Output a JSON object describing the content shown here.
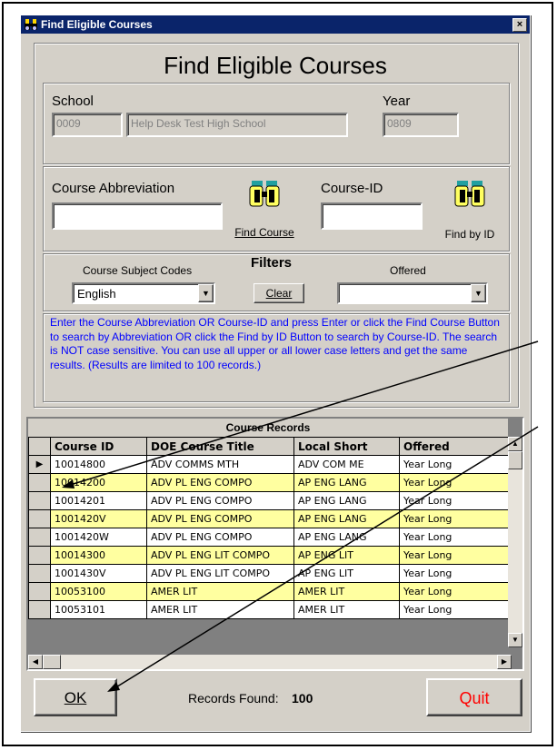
{
  "window": {
    "title": "Find Eligible Courses",
    "close_glyph": "×"
  },
  "header": {
    "title": "Find Eligible Courses"
  },
  "school": {
    "label": "School",
    "code": "0009",
    "name": "Help Desk Test High School"
  },
  "year": {
    "label": "Year",
    "value": "0809"
  },
  "search": {
    "abbrev_label": "Course Abbreviation",
    "abbrev_value": "",
    "find_course_label": "Find Course",
    "courseid_label": "Course-ID",
    "courseid_value": "",
    "find_by_id_label": "Find by ID"
  },
  "filters": {
    "title": "Filters",
    "subject_label": "Course Subject Codes",
    "subject_value": "English",
    "clear_label": "Clear",
    "offered_label": "Offered",
    "offered_value": ""
  },
  "instructions": "Enter the Course Abbreviation OR Course-ID and press Enter or click the Find Course Button to search by Abbreviation OR click the Find by ID Button to search by Course-ID.  The search is NOT case sensitive. You can use all upper or all lower case letters and get the same results. (Results are limited to 100 records.)",
  "table": {
    "caption": "Course Records",
    "columns": [
      "Course ID",
      "DOE Course Title",
      "Local Short",
      "Offered"
    ],
    "rows": [
      {
        "id": "10014800",
        "title": "ADV COMMS MTH",
        "short": "ADV COM ME",
        "offered": "Year Long",
        "highlight": false
      },
      {
        "id": "10014200",
        "title": "ADV PL ENG COMPO",
        "short": "AP ENG LANG",
        "offered": "Year Long",
        "highlight": true
      },
      {
        "id": "10014201",
        "title": "ADV PL ENG COMPO",
        "short": "AP ENG LANG",
        "offered": "Year Long",
        "highlight": false
      },
      {
        "id": "1001420V",
        "title": "ADV PL ENG COMPO",
        "short": "AP ENG LANG",
        "offered": "Year Long",
        "highlight": true
      },
      {
        "id": "1001420W",
        "title": "ADV PL ENG COMPO",
        "short": "AP ENG LANG",
        "offered": "Year Long",
        "highlight": false
      },
      {
        "id": "10014300",
        "title": "ADV PL ENG LIT COMPO",
        "short": "AP ENG LIT",
        "offered": "Year Long",
        "highlight": true
      },
      {
        "id": "1001430V",
        "title": "ADV PL ENG LIT COMPO",
        "short": "AP ENG LIT",
        "offered": "Year Long",
        "highlight": false
      },
      {
        "id": "10053100",
        "title": "AMER LIT",
        "short": "AMER LIT",
        "offered": "Year Long",
        "highlight": true
      },
      {
        "id": "10053101",
        "title": "AMER LIT",
        "short": "AMER LIT",
        "offered": "Year Long",
        "highlight": false
      }
    ]
  },
  "footer": {
    "ok_label": "OK",
    "records_found_label": "Records Found:",
    "records_found_value": "100",
    "quit_label": "Quit"
  },
  "colors": {
    "title_bar": "#0a246a",
    "instructions_text": "#0000ff",
    "quit_text": "#ff0000",
    "highlight_row": "#ffffa0"
  }
}
